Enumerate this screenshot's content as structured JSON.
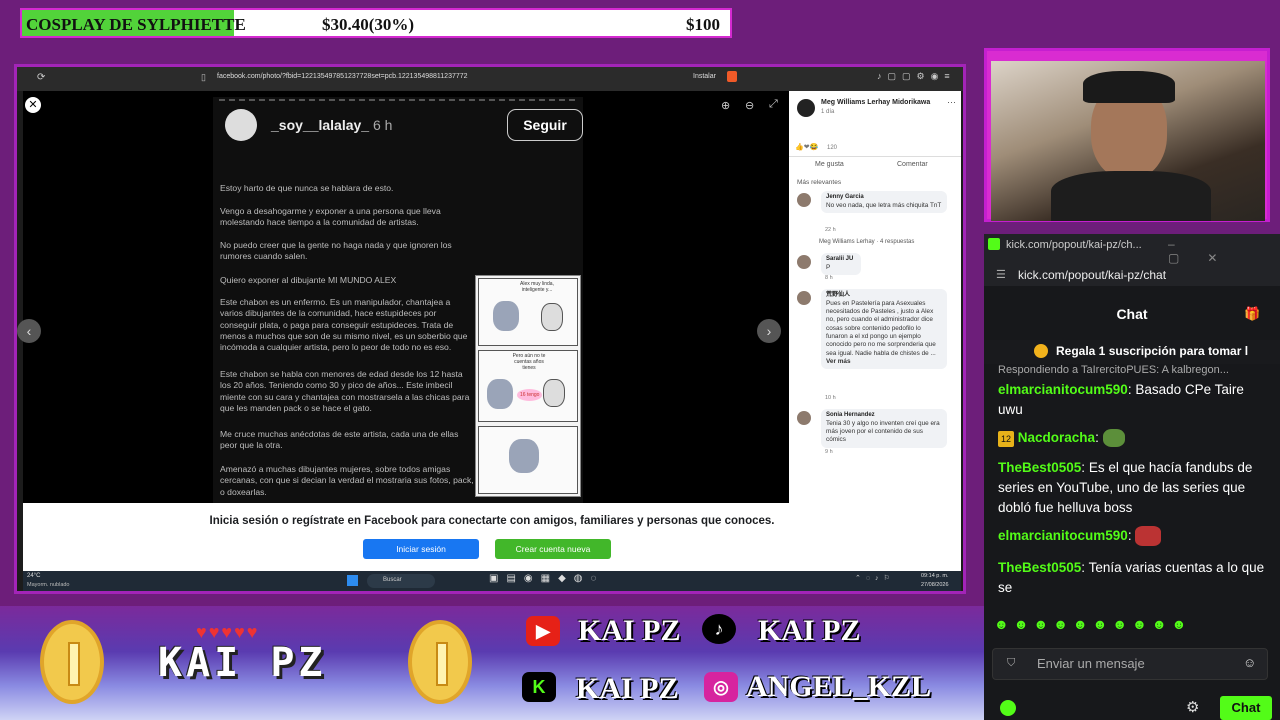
{
  "goal": {
    "title": "COSPLAY DE SYLPHIETTE",
    "current": "$30.40(30%)",
    "target": "$100",
    "progress": 0.3
  },
  "browser": {
    "url": "facebook.com/photo/?fbid=122135497851237728set=pcb.122135498811237772",
    "install_label": "Instalar",
    "post": {
      "username": "_soy__lalalay_",
      "time": "6 h",
      "follow_label": "Seguir",
      "paragraphs": [
        "Estoy harto de que nunca se hablara de esto.",
        "Vengo a desahogarme y exponer a una persona que lleva molestando hace tiempo a la comunidad de artistas.",
        "No puedo creer que la gente no haga nada y que ignoren los rumores cuando salen.",
        "Quiero exponer al dibujante MI MUNDO ALEX",
        "Este chabon es un enfermo. Es un manipulador, chantajea a varios dibujantes de la comunidad, hace estupideces por conseguir plata, o paga para conseguir estupideces. Trata de menos a muchos que son de su mismo nivel, es un soberbio que incómoda a cualquier artista, pero lo peor de todo no es eso.",
        "Este chabon se habla con menores de edad desde los 12 hasta los 20 años. Teniendo como 30 y pico de años... Este imbecil miente con su cara y chantajea con mostrarsela a las chicas para que les manden pack o se hace el gato.",
        "Me cruce muchas anécdotas de este artista, cada una de ellas peor que la otra.",
        "Amenazó a muchas dibujantes mujeres, sobre todos amigas cercanas, con que si decian la verdad el mostraria sus fotos, pack, o doxearlas."
      ],
      "comic_caption_1": "Alex muy linda, inteligente y...",
      "comic_caption_2": "Pero aún no te cuentas años tienes",
      "comic_caption_3": "16 tengo"
    },
    "fb": {
      "author": "Meg Williams Lerhay Midorikawa",
      "author_time": "1 día",
      "reactions": "120",
      "like_label": "Me gusta",
      "comment_label": "Comentar",
      "sort_label": "Más relevantes",
      "comments": [
        {
          "name": "Jenny Garcia",
          "text": "No veo nada, que letra más chiquita TnT",
          "time": "22 h"
        },
        {
          "name": "Meg Williams Lerhay",
          "text": "· 4 respuestas",
          "time": ""
        },
        {
          "name": "Saralii JU",
          "text": "P",
          "time": "8 h"
        },
        {
          "name": "荒野仙人",
          "text": "Pues en Pastelería para Asexuales necesitados de Pasteles , justo a Alex no, pero cuando el administrador dice cosas sobre contenido pedofilo lo funaron a el xd pongo un ejemplo conocido pero no me sorprenderia que sea igual. Nadie habla de chistes de ...",
          "more": "Ver más",
          "time": "10 h"
        },
        {
          "name": "Sonia Hernandez",
          "text": "Tenia 30 y algo no inventen creí que era más joven por el contenido de sus cómics",
          "time": "9 h"
        }
      ]
    },
    "login": {
      "message": "Inicia sesión o regístrate en Facebook para conectarte con amigos, familiares y personas que conoces.",
      "login_label": "Iniciar sesión",
      "signup_label": "Crear cuenta nueva"
    },
    "taskbar": {
      "weather_temp": "24°C",
      "weather_text": "Mayorm. nublado",
      "search_label": "Buscar",
      "time": "09:14 p. m.",
      "date": "27/08/2026"
    }
  },
  "chat": {
    "window_title": "kick.com/popout/kai-pz/ch...",
    "address": "kick.com/popout/kai-pz/chat",
    "header": "Chat",
    "pinned": "Regala 1 suscripción para tomar l",
    "reply_line": "Respondiendo a TaIrercitoPUES: A kalbregon...",
    "messages": [
      {
        "user": "elmarcianitocum590",
        "text": "Basado CPe Taire uwu"
      },
      {
        "user": "Nacdoracha",
        "text": "",
        "badge": "12"
      },
      {
        "user": "TheBest0505",
        "text": "Es el que hacía fandubs de series en YouTube, uno de las series que dobló fue helluva boss"
      },
      {
        "user": "elmarcianitocum590",
        "text": ""
      },
      {
        "user": "TheBest0505",
        "text": "Tenía varias cuentas a lo que se"
      }
    ],
    "input_placeholder": "Enviar un mensaje",
    "send_label": "Chat"
  },
  "overlay": {
    "name": "KAI PZ",
    "hearts": "♥♥♥♥♥",
    "youtube": "KAI PZ",
    "tiktok": "KAI PZ",
    "kick": "KAI PZ",
    "instagram": "ANGEL_KZL"
  },
  "colors": {
    "accent_purple": "#a324b8",
    "kick_green": "#53fc18",
    "fb_blue": "#1877f2",
    "fb_green": "#42b72a"
  }
}
